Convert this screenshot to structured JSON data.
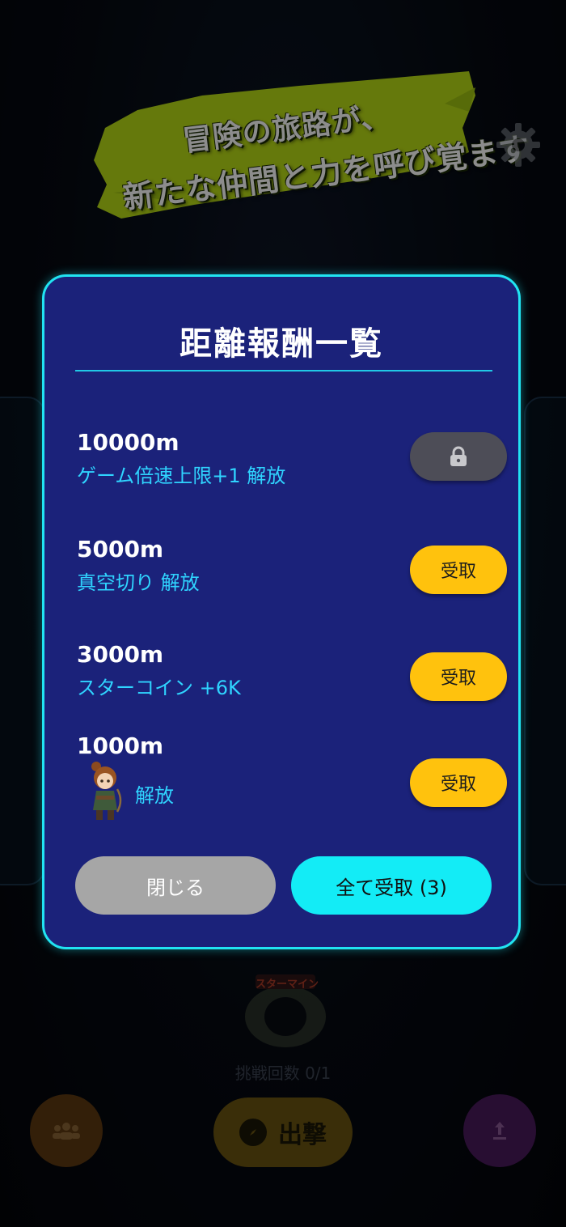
{
  "banner": {
    "line1": "冒険の旅路が、",
    "line2": "新たな仲間と力を呼び覚ます"
  },
  "modal": {
    "title": "距離報酬一覧",
    "rewards": [
      {
        "distance": "10000m",
        "description": "ゲーム倍速上限+1 解放",
        "status": "locked",
        "button": ""
      },
      {
        "distance": "5000m",
        "description": "真空切り 解放",
        "status": "claimable",
        "button": "受取"
      },
      {
        "distance": "3000m",
        "description": "スターコイン +6K",
        "status": "claimable",
        "button": "受取"
      },
      {
        "distance": "1000m",
        "description": "解放",
        "status": "claimable",
        "button": "受取"
      }
    ],
    "close_label": "閉じる",
    "claim_all_label": "全て受取 (3)"
  },
  "background": {
    "stage_label": "スターマイン",
    "attempts": "挑戦回数 0/1",
    "sortie_label": "出撃"
  },
  "colors": {
    "modal_bg": "#1b227a",
    "modal_border": "#21e4f2",
    "claim_button": "#ffc20d",
    "claim_all_button": "#13ecf6",
    "close_button": "#a6a6a6",
    "reward_text": "#2fd4ff"
  },
  "icons": [
    "gear-icon",
    "lock-icon",
    "team-icon",
    "compass-icon",
    "upload-icon"
  ]
}
